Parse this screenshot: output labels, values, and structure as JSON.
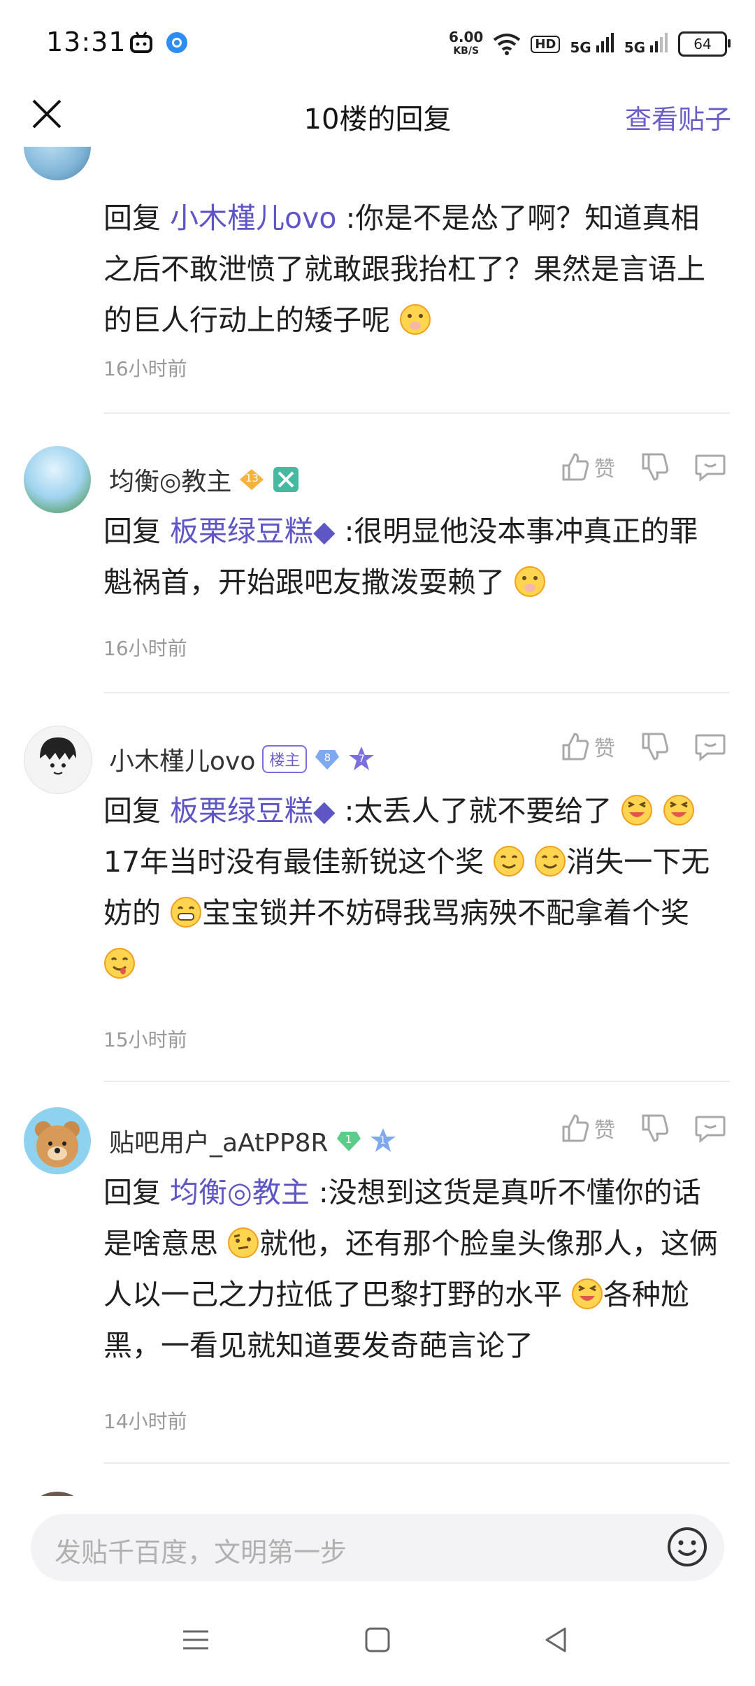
{
  "status_bar": {
    "time": "13:31",
    "net_speed_value": "6.00",
    "net_speed_unit": "KB/S",
    "hd_label": "HD",
    "sig1_label": "5G",
    "sig2_label": "5G",
    "battery": "64"
  },
  "header": {
    "title": "10楼的回复",
    "view_post": "查看贴子"
  },
  "posts": [
    {
      "reply_prefix": "回复",
      "mention": "小木槿儿ovo",
      "text": " :你是不是怂了啊？知道真相之后不敢泄愤了就敢跟我抬杠了？果然是言语上的巨人行动上的矮子呢",
      "time": "16小时前"
    },
    {
      "username": "均衡◎教主",
      "level": "13",
      "like_label": "赞",
      "reply_prefix": "回复",
      "mention": "板栗绿豆糕◆",
      "text": " :很明显他没本事冲真正的罪魁祸首，开始跟吧友撒泼耍赖了",
      "time": "16小时前"
    },
    {
      "username": "小木槿儿ovo",
      "owner_badge": "楼主",
      "level": "8",
      "level2": "7",
      "like_label": "赞",
      "reply_prefix": "回复",
      "mention": "板栗绿豆糕◆",
      "text_a": " :太丢人了就不要给了",
      "text_b": "17年当时没有最佳新锐这个奖",
      "text_c": "消失一下无妨的",
      "text_d": "宝宝锁并不妨碍我骂病殃不配拿着个奖",
      "time": "15小时前"
    },
    {
      "username": "贴吧用户_aAtPP8R",
      "level": "1",
      "level2": "1",
      "like_label": "赞",
      "reply_prefix": "回复",
      "mention": "均衡◎教主",
      "text_a": " :没想到这货是真听不懂你的话是啥意思",
      "text_b": "就他，还有那个脸皇头像那人，这俩人以一己之力拉低了巴黎打野的水平",
      "text_c": "各种尬黑，一看见就知道要发奇葩言论了",
      "time": "14小时前"
    }
  ],
  "composer": {
    "placeholder": "发贴千百度，文明第一步"
  },
  "colors": {
    "accent": "#6a5fc9",
    "text": "#1f1f1f",
    "muted": "#9a9a9a"
  }
}
